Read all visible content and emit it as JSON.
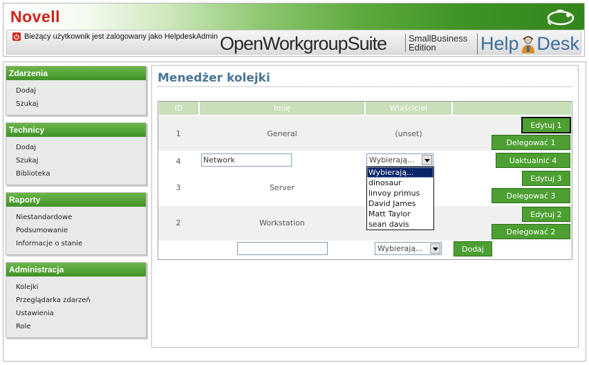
{
  "header": {
    "brand_logo": "Novell",
    "user_status": "Bieżący użytkownik jest zalogowany jako HelpdeskAdmin",
    "product": "OpenWorkgroupSuite",
    "edition_line1": "SmallBusiness",
    "edition_line2": "Edition",
    "helpdesk_left": "Help",
    "helpdesk_right": "Desk",
    "colors": {
      "accent_green": "#3f9226",
      "brand_red": "#d4211a",
      "helpdesk_blue": "#3a6e9c"
    }
  },
  "sidebar": {
    "panels": [
      {
        "title": "Zdarzenia",
        "items": [
          "Dodaj",
          "Szukaj"
        ]
      },
      {
        "title": "Technicy",
        "items": [
          "Dodaj",
          "Szukaj",
          "Biblioteka"
        ]
      },
      {
        "title": "Raporty",
        "items": [
          "Niestandardowe",
          "Podsumowanie",
          "Informacje o stanie"
        ]
      },
      {
        "title": "Administracja",
        "items": [
          "Kolejki",
          "Przeglądarka zdarzeń",
          "Ustawienia",
          "Role"
        ]
      }
    ]
  },
  "main": {
    "title": "Menedżer kolejki",
    "columns": [
      "ID",
      "Imię",
      "Właściciel",
      ""
    ],
    "rows": [
      {
        "id": "1",
        "name": "General",
        "owner": "(unset)",
        "edit": "Edytuj 1",
        "delegate": "Delegować 1"
      },
      {
        "id": "4",
        "name_value": "Network",
        "owner_select": "Wybierają...",
        "update": "Uaktualnić 4"
      },
      {
        "id": "3",
        "name": "Server",
        "edit": "Edytuj 3",
        "delegate": "Delegować 3"
      },
      {
        "id": "2",
        "name": "Workstation",
        "edit": "Edytuj 2",
        "delegate": "Delegować 2"
      }
    ],
    "new_row": {
      "name_value": "",
      "owner_select": "Wybierają...",
      "add": "Dodaj"
    },
    "owner_dropdown": {
      "options": [
        "Wybierają...",
        "dinosaur",
        "linvoy primus",
        "David James",
        "Matt Taylor",
        "sean davis"
      ],
      "selected_index": 0
    }
  }
}
